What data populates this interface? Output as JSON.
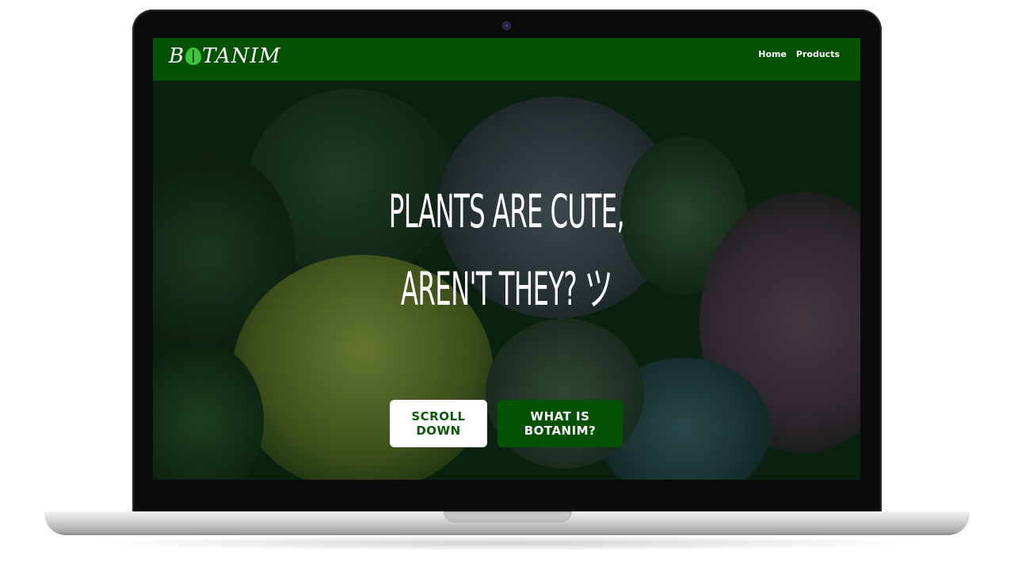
{
  "navbar": {
    "logo_text_before": "B",
    "logo_text_after": "TANIM",
    "links": [
      "Home",
      "Products"
    ]
  },
  "hero": {
    "title_line1": "PLANTS ARE CUTE,",
    "title_line2": "AREN'T THEY? ツ",
    "buttons": {
      "scroll": "SCROLL DOWN",
      "what": "WHAT IS BOTANIM?"
    }
  },
  "colors": {
    "brand_green": "#035203",
    "leaf_green": "#3ec63e",
    "text_white": "#ffffff"
  },
  "icons": {
    "logo_leaf": "leaf-icon"
  }
}
